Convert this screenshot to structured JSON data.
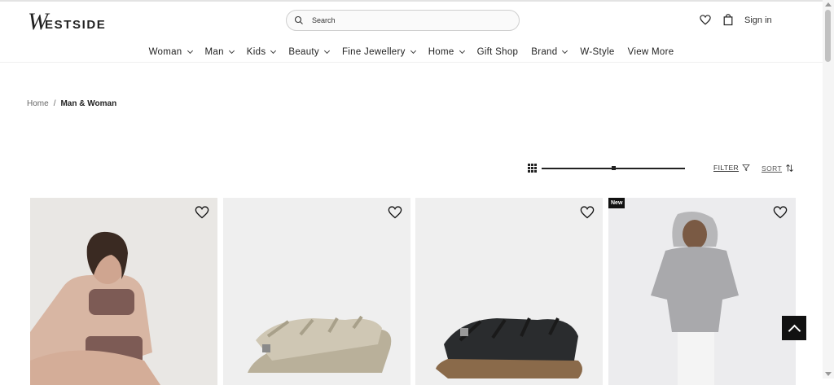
{
  "header": {
    "logo_w": "W",
    "logo_rest": "ESTSIDE",
    "search_placeholder": "Search",
    "signin_label": "Sign in"
  },
  "nav": {
    "items": [
      {
        "label": "Woman",
        "has_dropdown": true
      },
      {
        "label": "Man",
        "has_dropdown": true
      },
      {
        "label": "Kids",
        "has_dropdown": true
      },
      {
        "label": "Beauty",
        "has_dropdown": true
      },
      {
        "label": "Fine Jewellery",
        "has_dropdown": true
      },
      {
        "label": "Home",
        "has_dropdown": true
      },
      {
        "label": "Gift Shop",
        "has_dropdown": false
      },
      {
        "label": "Brand",
        "has_dropdown": true
      },
      {
        "label": "W-Style",
        "has_dropdown": false
      },
      {
        "label": "View More",
        "has_dropdown": false
      }
    ]
  },
  "breadcrumb": {
    "home": "Home",
    "separator": "/",
    "current": "Man & Woman"
  },
  "toolbar": {
    "filter_label": "FILTER",
    "sort_label": "SORT",
    "zoom_level": 0.5
  },
  "products": [
    {
      "image": "woman-mocha-sports-bra-set",
      "badge": ""
    },
    {
      "image": "beige-fisherman-sandal",
      "badge": ""
    },
    {
      "image": "black-fisherman-sandal",
      "badge": ""
    },
    {
      "image": "man-grey-hoodie",
      "badge": "New"
    }
  ],
  "colors": {
    "accent": "#111111",
    "text": "#222222",
    "card_bg": "#eeeeee"
  }
}
